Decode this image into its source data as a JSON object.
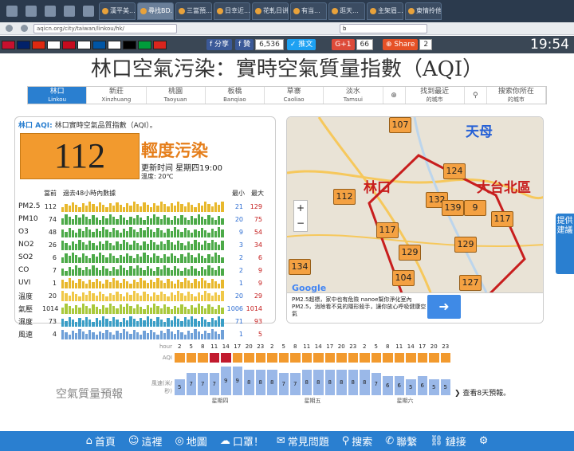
{
  "browser": {
    "tabs": [
      "漢平美...",
      "尋找BD...",
      "",
      "",
      "三當預...",
      "日幸近...",
      "花軋日讲",
      "有当...",
      "逛天...",
      "主架眉...",
      "東情拎他"
    ],
    "url": "aqicn.org/city/taiwan/linkou/hk/",
    "find": "b"
  },
  "sitebar": {
    "share_fb": "分享",
    "fb2": "贊",
    "fb_count": "6,536",
    "tweet": "推文",
    "gplus": "G+1",
    "gplus_count": "66",
    "share": "Share",
    "share_count": "2",
    "clock": "19:54"
  },
  "title": "林口空氣污染：實時空氣質量指數（AQI）",
  "cities": [
    {
      "zh": "林口",
      "en": "Linkou"
    },
    {
      "zh": "新莊",
      "en": "Xinzhuang"
    },
    {
      "zh": "桃園",
      "en": "Taoyuan"
    },
    {
      "zh": "板橋",
      "en": "Banqiao"
    },
    {
      "zh": "草寨",
      "en": "Caoliao"
    },
    {
      "zh": "淡水",
      "en": "Tamsui"
    },
    {
      "zh": "找到最近",
      "en": "的城市"
    },
    {
      "zh": "搜索你所在",
      "en": "的城市"
    }
  ],
  "panel": {
    "title_city": "林口 AQI:",
    "title_rest": " 林口實時空氣品質指數（AQI）。",
    "aqi": "112",
    "level": "輕度污染",
    "updated": "更新时间 星期四19:00",
    "temp": "溫度: 20℃",
    "col_now": "當前",
    "col_past": "過去48小時內數據",
    "col_min": "最小",
    "col_max": "最大",
    "rows": [
      {
        "name": "PM2.5",
        "val": "112",
        "min": "21",
        "max": "129",
        "color": "#e8b82c"
      },
      {
        "name": "PM10",
        "val": "74",
        "min": "20",
        "max": "75",
        "color": "#4caa48"
      },
      {
        "name": "O3",
        "val": "48",
        "min": "9",
        "max": "54",
        "color": "#4caa48"
      },
      {
        "name": "NO2",
        "val": "26",
        "min": "3",
        "max": "34",
        "color": "#4caa48"
      },
      {
        "name": "SO2",
        "val": "6",
        "min": "2",
        "max": "6",
        "color": "#4caa48"
      },
      {
        "name": "CO",
        "val": "7",
        "min": "2",
        "max": "9",
        "color": "#4caa48"
      },
      {
        "name": "UVI",
        "val": "1",
        "min": "1",
        "max": "9",
        "color": "#e8b82c"
      },
      {
        "name": "溫度",
        "val": "20",
        "min": "20",
        "max": "29",
        "color": "#f0c848"
      },
      {
        "name": "氣壓",
        "val": "1014",
        "min": "1006",
        "max": "1014",
        "color": "#a9c93a"
      },
      {
        "name": "濕度",
        "val": "73",
        "min": "71",
        "max": "93",
        "color": "#3a9ec6"
      },
      {
        "name": "風速",
        "val": "4",
        "min": "1",
        "max": "5",
        "color": "#6fa0d8"
      }
    ]
  },
  "map": {
    "markers": [
      "107",
      "124",
      "132",
      "139",
      "9",
      "117",
      "112",
      "117",
      "129",
      "129",
      "104",
      "127",
      "134"
    ],
    "label_tianmu": "天母",
    "label_linkou": "林口",
    "label_taipei": "大台北區",
    "ad": "PM2.5超標，家中也有危險 nanoe幫你淨化室內PM2.5，消除看不見的隱形殺手，讓你放心呼吸健康空氣",
    "google": "Google"
  },
  "feedback": "提供建議",
  "forecast": {
    "label": "空氣質量預報",
    "next": "查看8天預報。",
    "row_hour": "hour",
    "row_aqi": "AQI",
    "row_wind": "風速(米/秒)",
    "hours": [
      "2",
      "5",
      "8",
      "11",
      "14",
      "17",
      "20",
      "23",
      "2",
      "5",
      "8",
      "11",
      "14",
      "17",
      "20",
      "23",
      "2",
      "5",
      "8",
      "11",
      "14",
      "17",
      "20",
      "23"
    ],
    "wind": [
      "5",
      "7",
      "7",
      "7",
      "9",
      "9",
      "8",
      "8",
      "8",
      "7",
      "7",
      "8",
      "8",
      "8",
      "8",
      "8",
      "8",
      "7",
      "6",
      "6",
      "5",
      "6",
      "5",
      "5"
    ],
    "days": [
      "星期四",
      "星期五",
      "星期六"
    ]
  },
  "bottom": [
    "首頁",
    "這裡",
    "地圖",
    "口罩！",
    "常見問題",
    "搜索",
    "聯繫",
    "鏈接"
  ]
}
